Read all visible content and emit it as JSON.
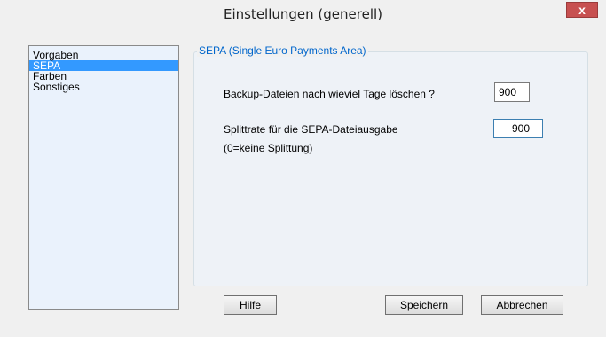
{
  "window": {
    "title": "Einstellungen (generell)",
    "close_label": "x"
  },
  "nav": {
    "items": [
      {
        "label": "Vorgaben",
        "selected": false
      },
      {
        "label": "SEPA",
        "selected": true
      },
      {
        "label": "Farben",
        "selected": false
      },
      {
        "label": "Sonstiges",
        "selected": false
      }
    ]
  },
  "sepa_group": {
    "legend": "SEPA (Single Euro Payments Area)",
    "backup_label": "Backup-Dateien nach wieviel Tage löschen ?",
    "backup_value": "900",
    "split_label": "Splittrate für die SEPA-Dateiausgabe",
    "split_hint": "(0=keine Splittung)",
    "split_value": "900"
  },
  "buttons": {
    "help": "Hilfe",
    "save": "Speichern",
    "cancel": "Abbrechen"
  },
  "colors": {
    "selection": "#3399ff",
    "legend": "#0066cc",
    "close_button": "#c75050"
  }
}
